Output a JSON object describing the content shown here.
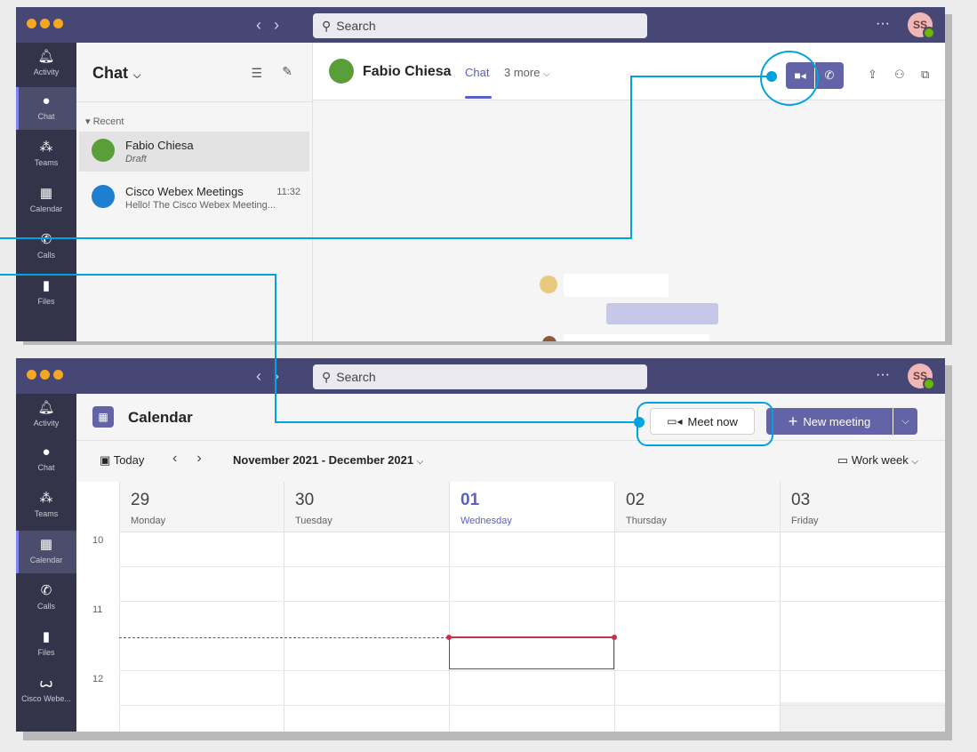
{
  "top_window": {
    "search_placeholder": "Search",
    "avatar_initials": "SS",
    "more_label": "···",
    "rail": [
      "Activity",
      "Chat",
      "Teams",
      "Calendar",
      "Calls",
      "Files"
    ],
    "chat_title": "Chat",
    "recent_label": "Recent",
    "chats": [
      {
        "name": "Fabio Chiesa",
        "sub": "Draft",
        "time": ""
      },
      {
        "name": "Cisco Webex Meetings",
        "sub": "Hello! The Cisco Webex Meeting...",
        "time": "11:32"
      }
    ],
    "conversation_name": "Fabio Chiesa",
    "tab_chat": "Chat",
    "tab_more": "3 more"
  },
  "bottom_window": {
    "search_placeholder": "Search",
    "avatar_initials": "SS",
    "more_label": "···",
    "rail": [
      "Activity",
      "Chat",
      "Teams",
      "Calendar",
      "Calls",
      "Files",
      "Cisco Webe..."
    ],
    "calendar_title": "Calendar",
    "meet_now": "Meet now",
    "new_meeting": "New meeting",
    "today": "Today",
    "date_range": "November 2021 - December 2021",
    "view": "Work week",
    "days": [
      {
        "num": "29",
        "name": "Monday"
      },
      {
        "num": "30",
        "name": "Tuesday"
      },
      {
        "num": "01",
        "name": "Wednesday"
      },
      {
        "num": "02",
        "name": "Thursday"
      },
      {
        "num": "03",
        "name": "Friday"
      }
    ],
    "hours": [
      "10",
      "11",
      "12"
    ]
  },
  "colors": {
    "titlebar": "#464775",
    "rail": "#33344a",
    "accent": "#6264a7",
    "callout": "#00a3e0",
    "now_line": "#c4314b"
  }
}
